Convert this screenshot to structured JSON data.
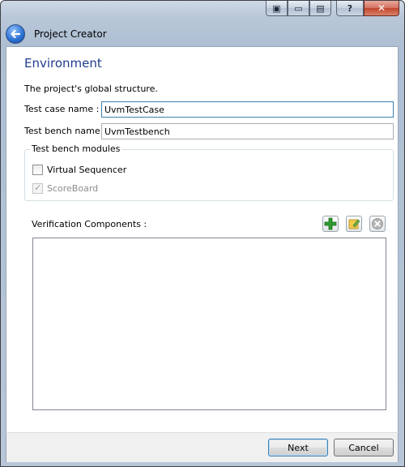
{
  "window": {
    "title": "Project Creator",
    "caption_buttons": [
      {
        "name": "restore-down-icon",
        "glyph": "▣"
      },
      {
        "name": "window-mode-icon",
        "glyph": "▭"
      },
      {
        "name": "tile-icon",
        "glyph": "▤"
      },
      {
        "name": "help-icon",
        "glyph": "?"
      },
      {
        "name": "close-icon",
        "glyph": "✕"
      }
    ]
  },
  "page": {
    "heading": "Environment",
    "description": "The project's global structure."
  },
  "form": {
    "test_case_label": "Test case name :",
    "test_case_value": "UvmTestCase",
    "test_bench_label": "Test bench name :",
    "test_bench_value": "UvmTestbench"
  },
  "modules": {
    "group_title": "Test bench modules",
    "virtual_sequencer": {
      "label": "Virtual Sequencer",
      "checked": false,
      "enabled": true
    },
    "scoreboard": {
      "label": "ScoreBoard",
      "checked": true,
      "enabled": false
    }
  },
  "components": {
    "label": "Verification Components :",
    "tools": [
      {
        "name": "add-icon",
        "color": "#2e9a2e"
      },
      {
        "name": "edit-icon",
        "color": "#e6b422"
      },
      {
        "name": "remove-icon",
        "color": "#9e9e9e"
      }
    ],
    "items": []
  },
  "footer": {
    "next_label": "Next",
    "cancel_label": "Cancel"
  },
  "colors": {
    "heading": "#1f3c8f",
    "accent": "#3c7fb1"
  }
}
